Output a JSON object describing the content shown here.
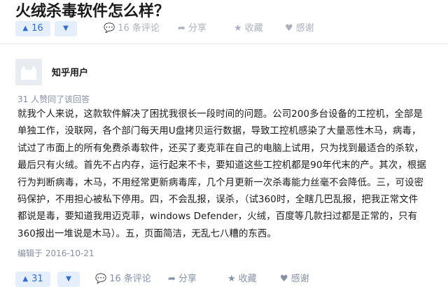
{
  "question_title": "火绒杀毒软件怎么样？",
  "top_actions": {
    "upvote_count": "16",
    "comments": "16 条评论",
    "share": "分享",
    "favorite": "收藏",
    "thanks": "感谢"
  },
  "answer": {
    "author": "知乎用户",
    "upvote_note": "31 人赞同了该回答",
    "lines": [
      "就我个人来说，这款软件解决了困扰我很长一段时间的问题。公司200多台设备的工控机，全部是",
      "单独工作，没联网，各个部门每天用U盘拷贝运行数据，导致工控机感染了大量恶性木马，病毒，",
      "试过了市面上的所有免费杀毒软件，还买了麦克菲在自己的电脑上试用，只为找到最适合的杀软，",
      "最后只有火绒。首先不占内存，运行起来不卡，要知道这些工控机都是90年代末的产。其次，根据",
      "行为判断病毒，木马，不用经常更新病毒库，几个月更新一次杀毒能力丝毫不会降低。三，可设密",
      "码保护，不用担心被私下停用。四，不会乱报，误杀，（试360时，全瞎几巴乱报，把我正常文件",
      "都说是毒，要知道我用迈克菲，windows Defender，火绒，百度等几款扫过都是正常的，只有",
      "360报出一堆说是木马）。五，页面简洁，无乱七八糟的东西。"
    ],
    "edited": "编辑于 2016-10-21",
    "upvote_count": "31",
    "comments": "16 条评论",
    "share": "分享",
    "favorite": "收藏",
    "thanks": "感谢"
  },
  "colors": {
    "accent": "#2d6fd6",
    "vote_bg": "#e5eefb",
    "muted": "#8590a6"
  }
}
